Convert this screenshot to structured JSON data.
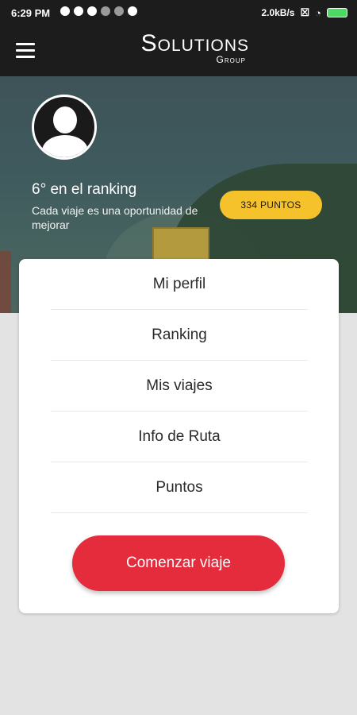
{
  "status_bar": {
    "time": "6:29 PM",
    "net_speed": "2.0kB/s"
  },
  "app_bar": {
    "logo_main": "Solutions",
    "logo_sub": "Group"
  },
  "profile": {
    "ranking": "6° en el ranking",
    "motto": "Cada viaje es una oportunidad de mejorar",
    "points_label": "334 PUNTOS"
  },
  "menu": {
    "items": [
      "Mi perfil",
      "Ranking",
      "Mis viajes",
      "Info de Ruta",
      "Puntos"
    ],
    "start_label": "Comenzar viaje"
  },
  "colors": {
    "accent_red": "#e52c3c",
    "points_yellow": "#f6c22b",
    "bar_dark": "#1c1c1c"
  }
}
